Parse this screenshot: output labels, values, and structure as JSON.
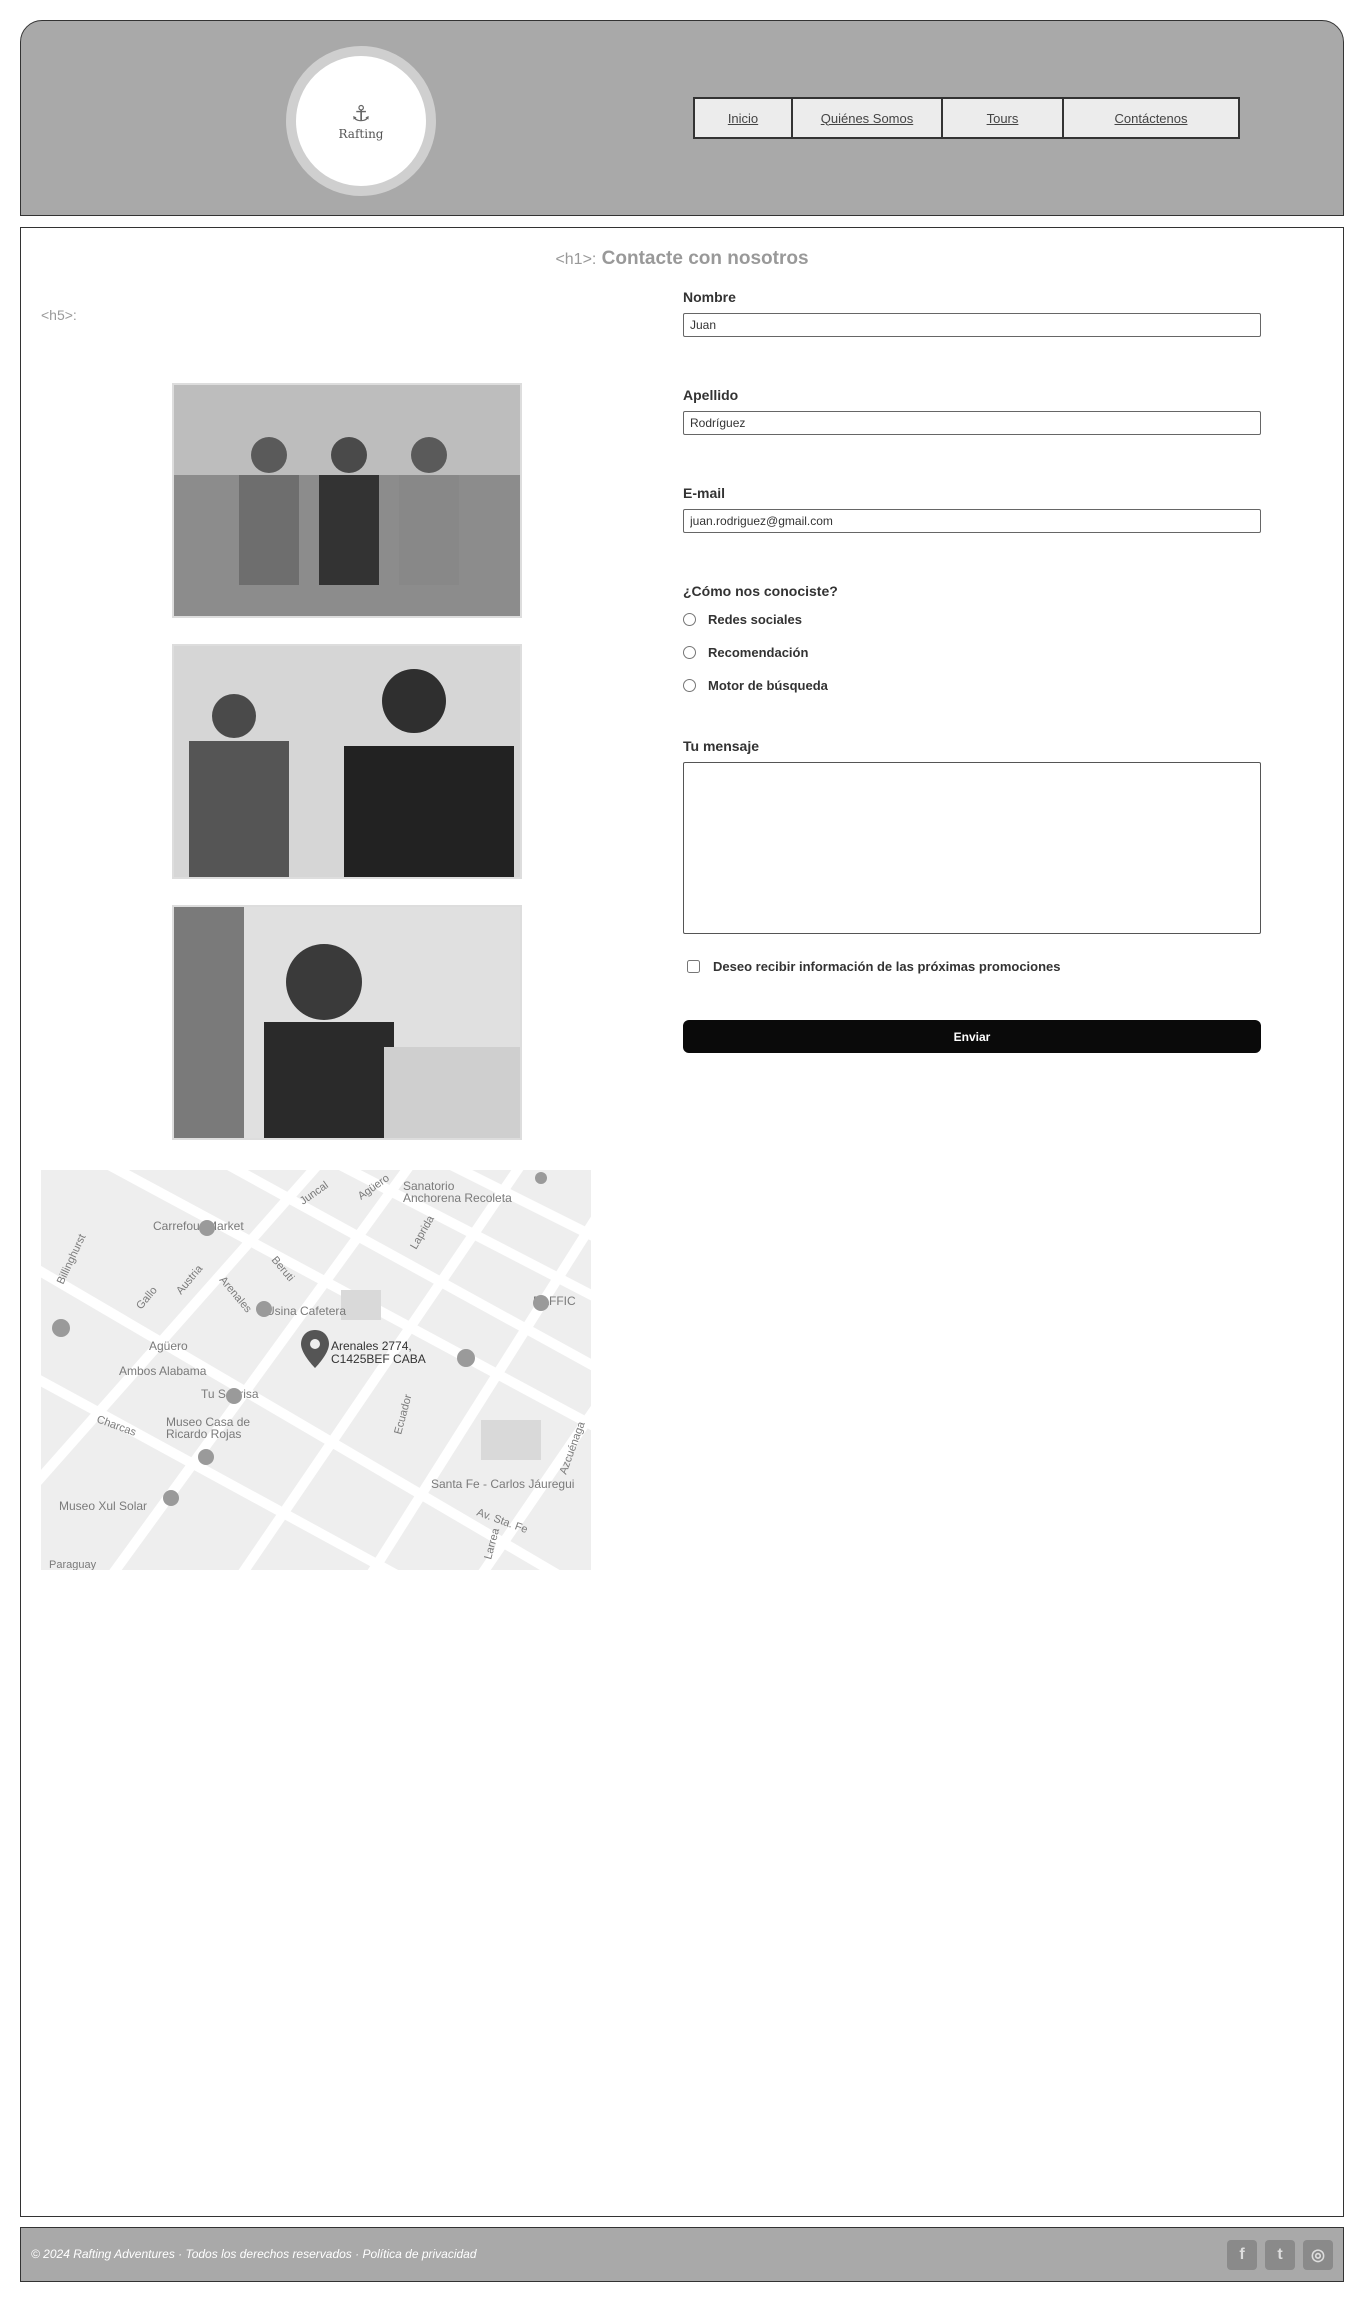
{
  "header": {
    "logo_text": "Rafting",
    "nav": [
      "Inicio",
      "Quiénes Somos",
      "Tours",
      "Contáctenos"
    ]
  },
  "main": {
    "title_tag": "<h1>:",
    "title": "Contacte con nosotros",
    "intro": "",
    "h5_tag": "<h5>:",
    "h5_text": "",
    "h5_para": "",
    "pre_team": "",
    "team": [
      {
        "caption": ""
      },
      {
        "caption": ""
      },
      {
        "caption": ""
      }
    ],
    "email_prefix": "",
    "email_link": "",
    "map_intro": "",
    "map": {
      "labels": [
        "Sanatorio Anchorena Recoleta",
        "Carrefour Market",
        "Usina Cafetera",
        "Agüero",
        "Ambos Alabama",
        "Tu Sonrisa",
        "Museo Casa de Ricardo Rojas",
        "Museo Xul Solar",
        "Santa Fe - Carlos Jáuregui",
        "BAFFIC",
        "Arenales 2774, C1425BEF CABA"
      ],
      "streets": [
        "Juncal",
        "Agüero",
        "Laprida",
        "Beruti",
        "Arenales",
        "Austria",
        "Gallo",
        "Charcas",
        "Ecuador",
        "Av. Sta. Fe",
        "Larrea",
        "Azcuénaga",
        "Billinghurst",
        "Paraguay"
      ]
    }
  },
  "form": {
    "name_label": "Nombre",
    "name_value": "Juan",
    "last_label": "Apellido",
    "last_value": "Rodríguez",
    "email_label": "E-mail",
    "email_value": "juan.rodriguez@gmail.com",
    "radio_label": "¿Cómo nos conociste?",
    "radios": [
      "Redes sociales",
      "Recomendación",
      "Motor de búsqueda"
    ],
    "message_label": "Tu mensaje",
    "checkbox_label": "Deseo recibir información de las próximas promociones",
    "submit": "Enviar"
  },
  "footer": {
    "text": "© 2024 Rafting Adventures · Todos los derechos reservados · Política de privacidad",
    "social": [
      "facebook-icon",
      "twitter-icon",
      "instagram-icon"
    ]
  }
}
